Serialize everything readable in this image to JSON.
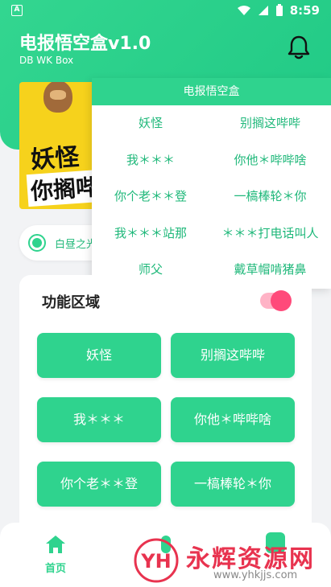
{
  "status_bar": {
    "time": "8:59",
    "left_icon": "A"
  },
  "app": {
    "title": "电报悟空盒v1.0",
    "subtitle": "DB WK Box"
  },
  "banner": {
    "line1": "妖怪",
    "line2": "你搁哔"
  },
  "notice": {
    "text": "白昼之光"
  },
  "popup": {
    "title": "电报悟空盒",
    "items": [
      "妖怪",
      "别搁这哔哔",
      "我＊＊＊",
      "你他＊哔哔啥",
      "你个老＊＊登",
      "一槁棒轮＊你",
      "我＊＊＊站那",
      "＊＊＊打电话叫人",
      "师父",
      "戴草帽啃猪鼻"
    ]
  },
  "panel": {
    "title": "功能区域",
    "toggle_on": true,
    "buttons": [
      "妖怪",
      "别搁这哔哔",
      "我＊＊＊",
      "你他＊哔哔啥",
      "你个老＊＊登",
      "一槁棒轮＊你"
    ]
  },
  "bottom_nav": {
    "home_label": "首页"
  },
  "watermark": {
    "title": "永辉资源网",
    "url": "www.yhkjjs.com",
    "logo_text": "YH"
  },
  "colors": {
    "accent": "#2fd38e",
    "toggle": "#ff4a7a"
  }
}
